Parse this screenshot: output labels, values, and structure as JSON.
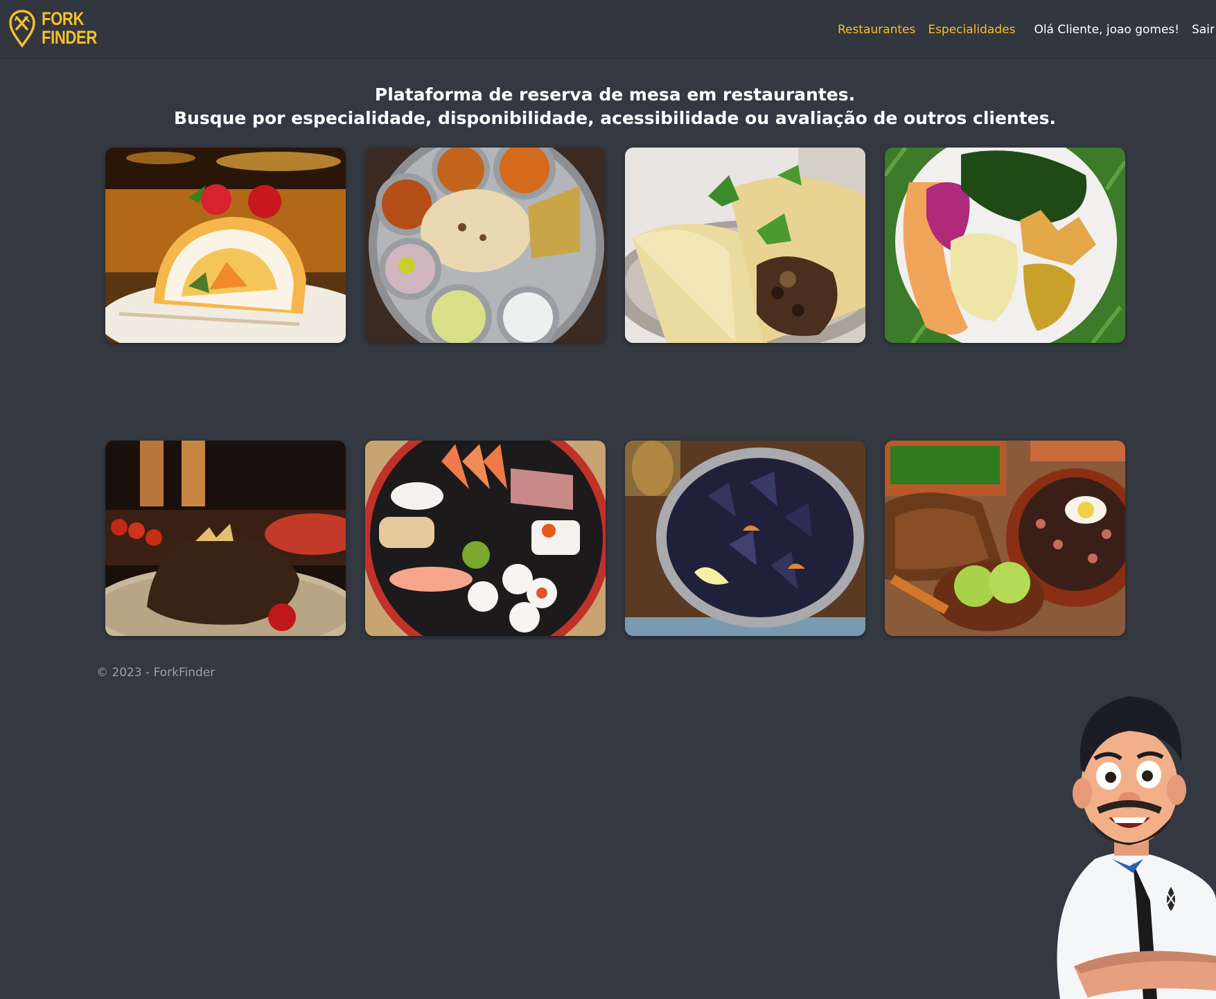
{
  "brand": {
    "line1": "FORK",
    "line2": "FINDER",
    "color": "#f5c02a"
  },
  "nav": {
    "restaurants": "Restaurantes",
    "specialties": "Especialidades",
    "greeting": "Olá Cliente, joao gomes!",
    "logout": "Sair"
  },
  "hero": {
    "line1": "Plataforma de reserva de mesa em restaurantes.",
    "line2": "Busque por especialidade, disponibilidade, acessibilidade ou avaliação de outros clientes."
  },
  "footer": {
    "copyright": "© 2023 - ForkFinder"
  },
  "theme": {
    "background": "#343841",
    "navbar": "#32363e",
    "accent": "#f5c02a"
  }
}
